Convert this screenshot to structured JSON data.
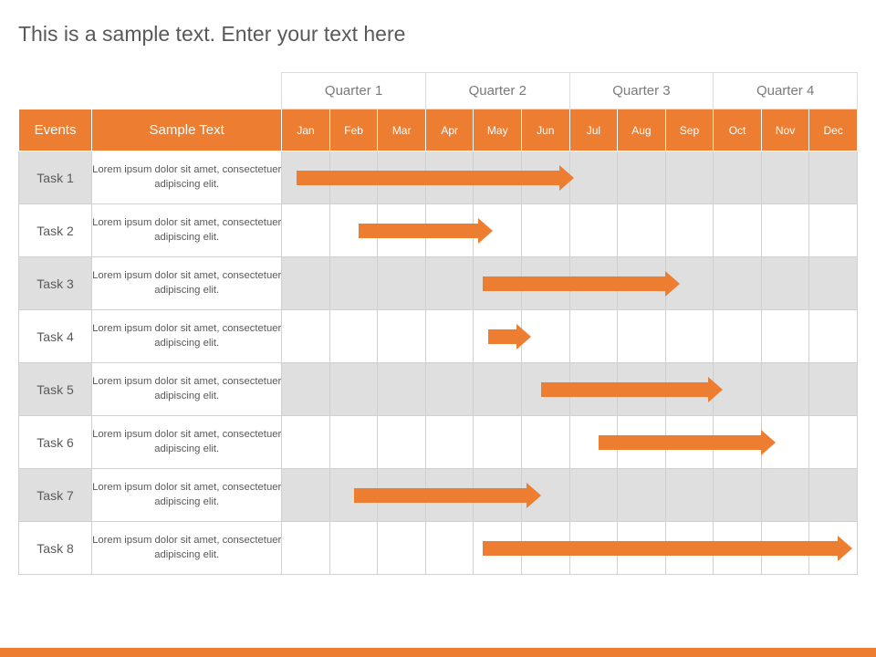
{
  "title": "This is a sample text. Enter your text here",
  "headers": {
    "events": "Events",
    "sample_text": "Sample Text",
    "quarters": [
      "Quarter 1",
      "Quarter 2",
      "Quarter 3",
      "Quarter 4"
    ],
    "months": [
      "Jan",
      "Feb",
      "Mar",
      "Apr",
      "May",
      "Jun",
      "Jul",
      "Aug",
      "Sep",
      "Oct",
      "Nov",
      "Dec"
    ]
  },
  "rows": [
    {
      "task": "Task 1",
      "desc": "Lorem ipsum dolor sit amet, consectetuer adipiscing elit."
    },
    {
      "task": "Task 2",
      "desc": "Lorem ipsum dolor sit amet, consectetuer adipiscing elit."
    },
    {
      "task": "Task 3",
      "desc": "Lorem ipsum dolor sit amet, consectetuer adipiscing elit."
    },
    {
      "task": "Task 4",
      "desc": "Lorem ipsum dolor sit amet, consectetuer adipiscing elit."
    },
    {
      "task": "Task 5",
      "desc": "Lorem ipsum dolor sit amet, consectetuer adipiscing elit."
    },
    {
      "task": "Task 6",
      "desc": "Lorem ipsum dolor sit amet, consectetuer adipiscing elit."
    },
    {
      "task": "Task 7",
      "desc": "Lorem ipsum dolor sit amet, consectetuer adipiscing elit."
    },
    {
      "task": "Task 8",
      "desc": "Lorem ipsum dolor sit amet, consectetuer adipiscing elit."
    }
  ],
  "colors": {
    "accent": "#ED7D31",
    "band": "#dfdfdf",
    "text": "#595959"
  },
  "chart_data": {
    "type": "bar",
    "title": "This is a sample text. Enter your text here",
    "xlabel": "",
    "ylabel": "",
    "x_categories": [
      "Jan",
      "Feb",
      "Mar",
      "Apr",
      "May",
      "Jun",
      "Jul",
      "Aug",
      "Sep",
      "Oct",
      "Nov",
      "Dec"
    ],
    "quarters": [
      "Quarter 1",
      "Quarter 2",
      "Quarter 3",
      "Quarter 4"
    ],
    "series": [
      {
        "name": "Task 1",
        "start_month": "Jan",
        "end_month": "Jul",
        "start_index": 1,
        "end_index": 7,
        "start_offset": 0.3,
        "end_offset": 0.1
      },
      {
        "name": "Task 2",
        "start_month": "Feb",
        "end_month": "May",
        "start_index": 2,
        "end_index": 5,
        "start_offset": 0.6,
        "end_offset": 0.4
      },
      {
        "name": "Task 3",
        "start_month": "May",
        "end_month": "Sep",
        "start_index": 5,
        "end_index": 9,
        "start_offset": 0.2,
        "end_offset": 0.3
      },
      {
        "name": "Task 4",
        "start_month": "May",
        "end_month": "Jun",
        "start_index": 5,
        "end_index": 6,
        "start_offset": 0.3,
        "end_offset": 0.2
      },
      {
        "name": "Task 5",
        "start_month": "Jun",
        "end_month": "Oct",
        "start_index": 6,
        "end_index": 10,
        "start_offset": 0.4,
        "end_offset": 0.2
      },
      {
        "name": "Task 6",
        "start_month": "Jul",
        "end_month": "Nov",
        "start_index": 7,
        "end_index": 11,
        "start_offset": 0.6,
        "end_offset": 0.3
      },
      {
        "name": "Task 7",
        "start_month": "Feb",
        "end_month": "Jun",
        "start_index": 2,
        "end_index": 6,
        "start_offset": 0.5,
        "end_offset": 0.4
      },
      {
        "name": "Task 8",
        "start_month": "May",
        "end_month": "Dec",
        "start_index": 5,
        "end_index": 12,
        "start_offset": 0.2,
        "end_offset": 0.9
      }
    ]
  }
}
